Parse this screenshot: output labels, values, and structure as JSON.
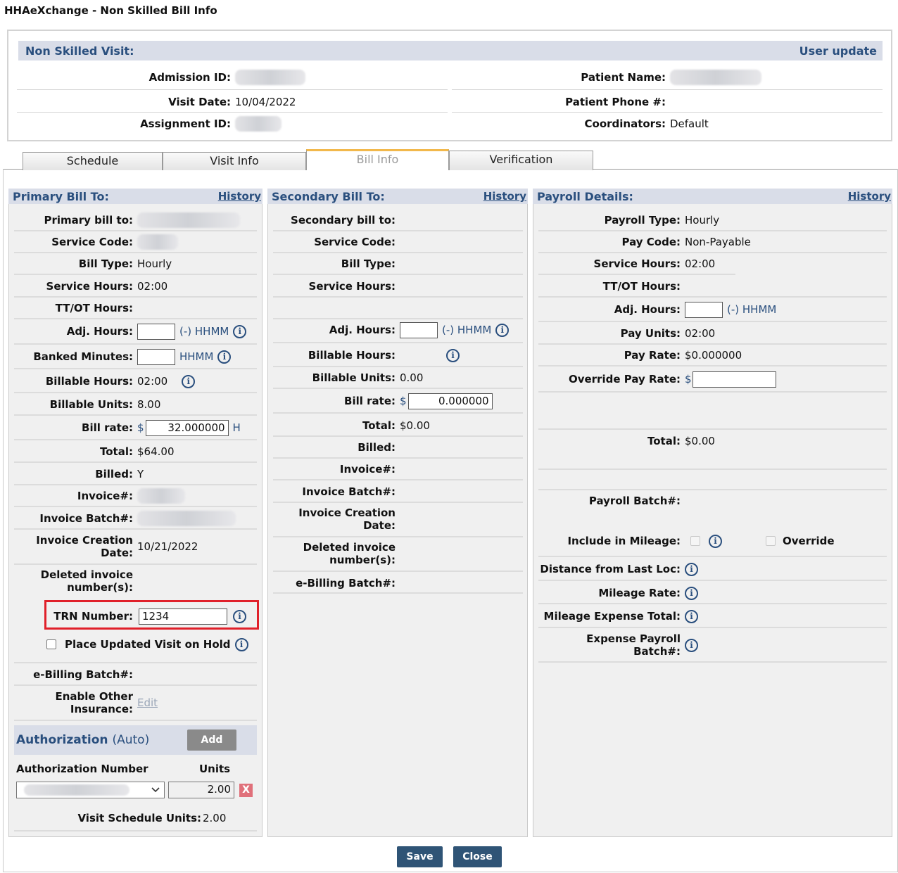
{
  "window": {
    "title": "HHAeXchange - Non Skilled Bill Info"
  },
  "header": {
    "title": "Non Skilled Visit:",
    "user_update": "User update",
    "admission_id_label": "Admission ID:",
    "visit_date_label": "Visit Date:",
    "visit_date": "10/04/2022",
    "assignment_id_label": "Assignment ID:",
    "patient_name_label": "Patient Name:",
    "patient_phone_label": "Patient Phone #:",
    "coordinators_label": "Coordinators:",
    "coordinators": "Default"
  },
  "tabs": [
    {
      "label": "Schedule"
    },
    {
      "label": "Visit Info"
    },
    {
      "label": "Bill Info",
      "active": true
    },
    {
      "label": "Verification"
    }
  ],
  "primary": {
    "title": "Primary Bill To:",
    "history": "History",
    "primary_bill_to_label": "Primary bill to:",
    "service_code_label": "Service Code:",
    "bill_type_label": "Bill Type:",
    "bill_type": "Hourly",
    "service_hours_label": "Service Hours:",
    "service_hours": "02:00",
    "ttot_label": "TT/OT Hours:",
    "adj_hours_label": "Adj. Hours:",
    "adj_hint": "(-) HHMM",
    "banked_label": "Banked Minutes:",
    "banked_hint": "HHMM",
    "billable_hours_label": "Billable Hours:",
    "billable_hours": "02:00",
    "billable_units_label": "Billable Units:",
    "billable_units": "8.00",
    "bill_rate_label": "Bill rate:",
    "currency": "$",
    "bill_rate": "32.000000",
    "rate_unit": "H",
    "total_label": "Total:",
    "total": "$64.00",
    "billed_label": "Billed:",
    "billed": "Y",
    "invoice_label": "Invoice#:",
    "invoice_batch_label": "Invoice Batch#:",
    "invoice_creation_label_1": "Invoice Creation",
    "invoice_creation_label_2": "Date:",
    "invoice_creation": "10/21/2022",
    "deleted_label_1": "Deleted invoice",
    "deleted_label_2": "number(s):",
    "trn_label": "TRN Number:",
    "trn_value": "1234",
    "hold_label": "Place Updated Visit on Hold",
    "ebilling_label": "e-Billing Batch#:",
    "enable_label_1": "Enable Other",
    "enable_label_2": "Insurance:",
    "edit": "Edit"
  },
  "authorization": {
    "title": "Authorization",
    "auto": "(Auto)",
    "add": "Add",
    "number_header": "Authorization Number",
    "units_header": "Units",
    "units_value": "2.00",
    "remove": "X",
    "schedule_units_label": "Visit Schedule Units:",
    "schedule_units": "2.00"
  },
  "secondary": {
    "title": "Secondary Bill To:",
    "history": "History",
    "secondary_bill_to_label": "Secondary bill to:",
    "service_code_label": "Service Code:",
    "bill_type_label": "Bill Type:",
    "service_hours_label": "Service Hours:",
    "adj_hours_label": "Adj. Hours:",
    "adj_hint": "(-) HHMM",
    "billable_hours_label": "Billable Hours:",
    "billable_units_label": "Billable Units:",
    "billable_units": "0.00",
    "bill_rate_label": "Bill rate:",
    "currency": "$",
    "bill_rate": "0.000000",
    "total_label": "Total:",
    "total": "$0.00",
    "billed_label": "Billed:",
    "invoice_label": "Invoice#:",
    "invoice_batch_label": "Invoice Batch#:",
    "invoice_creation_label_1": "Invoice Creation",
    "invoice_creation_label_2": "Date:",
    "deleted_label_1": "Deleted invoice",
    "deleted_label_2": "number(s):",
    "ebilling_label": "e-Billing Batch#:"
  },
  "payroll": {
    "title": "Payroll Details:",
    "history": "History",
    "payroll_type_label": "Payroll Type:",
    "payroll_type": "Hourly",
    "pay_code_label": "Pay Code:",
    "pay_code": "Non-Payable",
    "service_hours_label": "Service Hours:",
    "service_hours": "02:00",
    "ttot_label": "TT/OT Hours:",
    "adj_hours_label": "Adj. Hours:",
    "adj_hint": "(-) HHMM",
    "pay_units_label": "Pay Units:",
    "pay_units": "02:00",
    "pay_rate_label": "Pay Rate:",
    "pay_rate": "$0.000000",
    "override_label": "Override Pay Rate:",
    "currency": "$",
    "total_label": "Total:",
    "total": "$0.00",
    "payroll_batch_label": "Payroll Batch#:",
    "mileage_label": "Include in Mileage:",
    "override_cb_label": "Override",
    "distance_label": "Distance from Last Loc:",
    "mileage_rate_label": "Mileage Rate:",
    "mileage_total_label": "Mileage Expense Total:",
    "expense_batch_label_1": "Expense Payroll",
    "expense_batch_label_2": "Batch#:"
  },
  "icons": {
    "info": "i"
  },
  "footer": {
    "save": "Save",
    "close": "Close"
  }
}
